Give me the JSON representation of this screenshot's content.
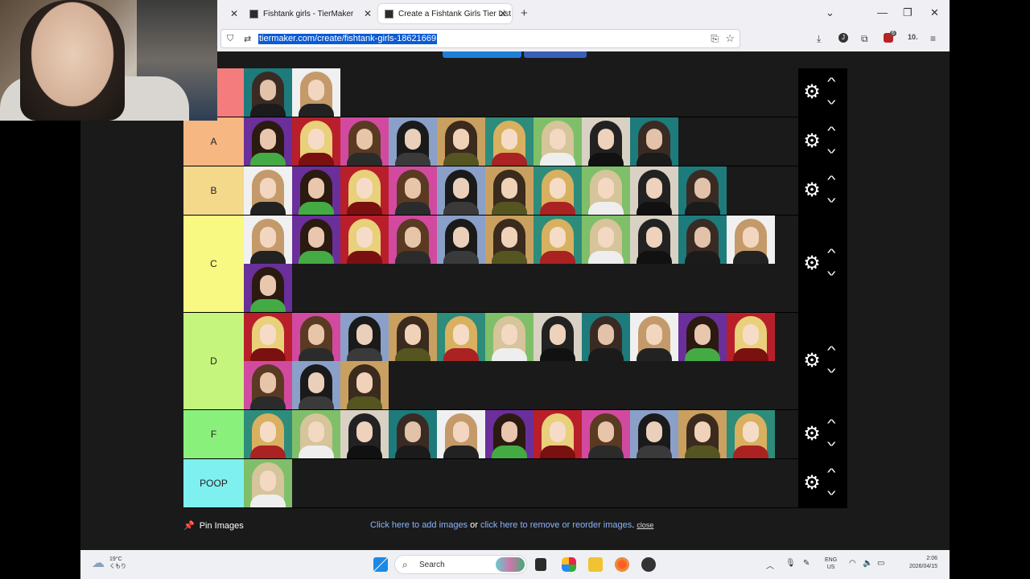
{
  "browser": {
    "tabs": [
      {
        "label": "Fishtank girls - TierMaker"
      },
      {
        "label": "Create a Fishtank Girls Tier List"
      }
    ],
    "url": "tiermaker.com/create/fishtank-girls-18621669",
    "new_tab": "+",
    "account_initial": "J",
    "badge_count": "6",
    "ext_label": "10."
  },
  "tiers": [
    {
      "label": "",
      "color": "#f47c7c",
      "count": 2
    },
    {
      "label": "A",
      "color": "#f7b782",
      "count": 9
    },
    {
      "label": "B",
      "color": "#f4d98a",
      "count": 10
    },
    {
      "label": "C",
      "color": "#f8f982",
      "count": 12
    },
    {
      "label": "D",
      "color": "#c5f57c",
      "count": 14
    },
    {
      "label": "F",
      "color": "#8af07c",
      "count": 11
    },
    {
      "label": "POOP",
      "color": "#7ef0f0",
      "count": 1
    }
  ],
  "footer": {
    "pin_label": "Pin Images",
    "add_link": "Click here to add images",
    "or_text": " or ",
    "remove_link": "click here to remove or reorder images",
    "period": ".",
    "close_label": "close"
  },
  "taskbar": {
    "weather_temp": "19°C",
    "weather_desc": "くもり",
    "search_placeholder": "Search",
    "lang_top": "ENG",
    "lang_bottom": "US",
    "time": "2:06",
    "date": "2026/04/15"
  }
}
